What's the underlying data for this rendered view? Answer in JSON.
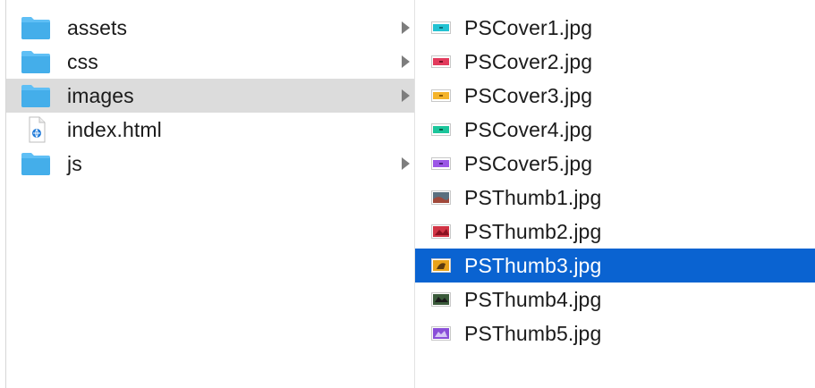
{
  "column_one": {
    "items": [
      {
        "label": "assets",
        "type": "folder"
      },
      {
        "label": "css",
        "type": "folder"
      },
      {
        "label": "images",
        "type": "folder"
      },
      {
        "label": "index.html",
        "type": "html-file"
      },
      {
        "label": "js",
        "type": "folder"
      }
    ]
  },
  "column_two": {
    "items": [
      {
        "label": "PSCover1.jpg",
        "color": "#23c2d2"
      },
      {
        "label": "PSCover2.jpg",
        "color": "#e23a5c"
      },
      {
        "label": "PSCover3.jpg",
        "color": "#f4b32a"
      },
      {
        "label": "PSCover4.jpg",
        "color": "#1cc59b"
      },
      {
        "label": "PSCover5.jpg",
        "color": "#9b56e6"
      },
      {
        "label": "PSThumb1.jpg",
        "color": "#5a6f7f"
      },
      {
        "label": "PSThumb2.jpg",
        "color": "#d13445"
      },
      {
        "label": "PSThumb3.jpg",
        "color": "#e8a31b"
      },
      {
        "label": "PSThumb4.jpg",
        "color": "#3a5a3a"
      },
      {
        "label": "PSThumb5.jpg",
        "color": "#8a4fd8"
      }
    ]
  },
  "colors": {
    "selection_blue": "#0a63d1",
    "selection_gray": "#dcdcdc",
    "folder_blue": "#4db4f0"
  }
}
